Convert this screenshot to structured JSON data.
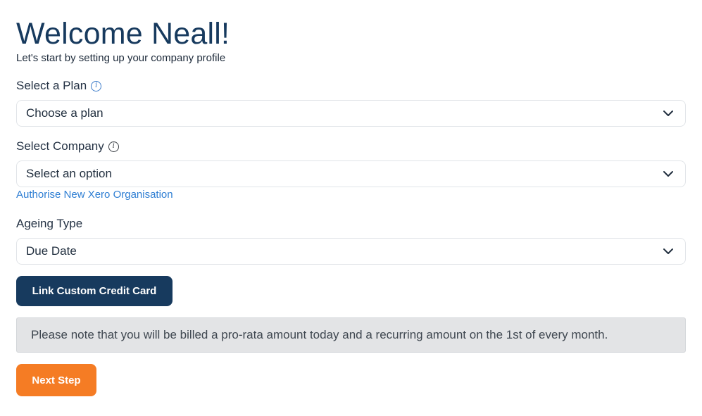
{
  "header": {
    "title": "Welcome Neall!",
    "subtitle": "Let's start by setting up your company profile"
  },
  "form": {
    "plan": {
      "label": "Select a Plan",
      "info_icon": "info-icon",
      "value": "Choose a plan"
    },
    "company": {
      "label": "Select Company",
      "info_icon": "info-icon",
      "value": "Select an option",
      "link_label": "Authorise New Xero Organisation"
    },
    "ageing": {
      "label": "Ageing Type",
      "value": "Due Date"
    },
    "chevron_icon": "chevron-down-icon"
  },
  "actions": {
    "link_card_label": "Link Custom Credit Card",
    "next_label": "Next Step"
  },
  "notice": {
    "text": "Please note that you will be billed a pro-rata amount today and a recurring amount on the 1st of every month."
  },
  "colors": {
    "primary": "#173a5e",
    "accent": "#f57c24",
    "link": "#2e7ed3",
    "notice_bg": "#e3e4e6"
  }
}
